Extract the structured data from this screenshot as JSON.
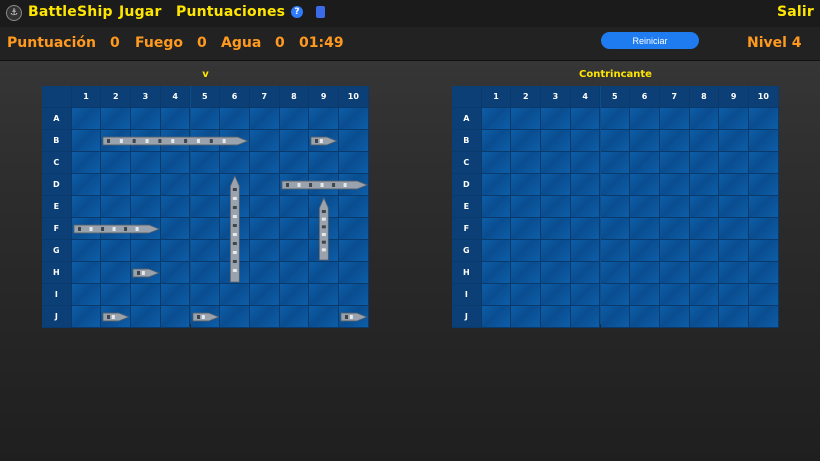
{
  "nav": {
    "logo_icon": "battleship-logo-icon",
    "title": "BattleShip",
    "play": "Jugar",
    "scores": "Puntuaciones",
    "help_icon": "help-icon",
    "help_glyph": "?",
    "book_icon": "book-icon",
    "exit": "Salir"
  },
  "status": {
    "score_label": "Puntuación",
    "score": "0",
    "fire_label": "Fuego",
    "fire": "0",
    "water_label": "Agua",
    "water": "0",
    "time": "01:49",
    "restart": "Reiniciar",
    "level": "Nivel 4"
  },
  "boards": {
    "player_title": "v",
    "opponent_title": "Contrincante",
    "columns": [
      "1",
      "2",
      "3",
      "4",
      "5",
      "6",
      "7",
      "8",
      "9",
      "10"
    ],
    "rows": [
      "A",
      "B",
      "C",
      "D",
      "E",
      "F",
      "G",
      "H",
      "I",
      "J"
    ]
  },
  "ships": [
    {
      "name": "carrier-ship",
      "row": "B",
      "col": 2,
      "length": 5,
      "orientation": "horizontal"
    },
    {
      "name": "patrol-boat",
      "row": "B",
      "col": 9,
      "length": 1,
      "orientation": "horizontal"
    },
    {
      "name": "battleship-vertical",
      "row": "D",
      "col": 6,
      "length": 5,
      "orientation": "vertical"
    },
    {
      "name": "cruiser-ship",
      "row": "D",
      "col": 8,
      "length": 3,
      "orientation": "horizontal"
    },
    {
      "name": "destroyer-vertical",
      "row": "E",
      "col": 9,
      "length": 3,
      "orientation": "vertical"
    },
    {
      "name": "submarine-ship",
      "row": "F",
      "col": 1,
      "length": 3,
      "orientation": "horizontal"
    },
    {
      "name": "patrol-boat",
      "row": "H",
      "col": 3,
      "length": 1,
      "orientation": "horizontal"
    },
    {
      "name": "patrol-boat",
      "row": "J",
      "col": 2,
      "length": 1,
      "orientation": "horizontal"
    },
    {
      "name": "patrol-boat",
      "row": "J",
      "col": 5,
      "length": 1,
      "orientation": "horizontal"
    },
    {
      "name": "patrol-boat",
      "row": "J",
      "col": 10,
      "length": 1,
      "orientation": "horizontal"
    }
  ],
  "colors": {
    "accent": "#ffe600",
    "status": "#ff9a1f",
    "button": "#1e7cf0",
    "water": "#0d5ea8"
  }
}
